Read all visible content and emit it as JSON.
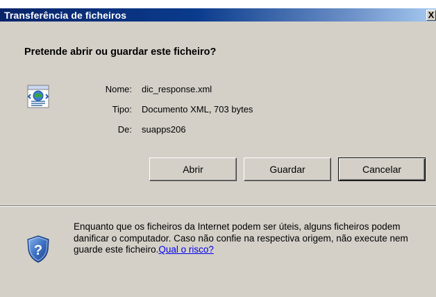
{
  "window": {
    "title": "Transferência de ficheiros",
    "close_label": "X"
  },
  "dialog": {
    "question": "Pretende abrir ou guardar este ficheiro?",
    "file_icon": "xml-document-icon",
    "info": [
      {
        "label": "Nome:",
        "value": "dic_response.xml"
      },
      {
        "label": "Tipo:",
        "value": "Documento XML, 703 bytes"
      },
      {
        "label": "De:",
        "value": "suapps206"
      }
    ],
    "buttons": {
      "open": "Abrir",
      "save": "Guardar",
      "cancel": "Cancelar"
    }
  },
  "warning": {
    "icon": "shield-question-icon",
    "text": "Enquanto que os ficheiros da Internet podem ser úteis, alguns ficheiros podem danificar o computador. Caso não confie na respectiva origem, não execute nem guarde este ficheiro.",
    "link": "Qual o risco?"
  },
  "colors": {
    "title_bar": "#0a246a",
    "dialog_bg": "#d4d0c8",
    "link": "#0000ee"
  }
}
